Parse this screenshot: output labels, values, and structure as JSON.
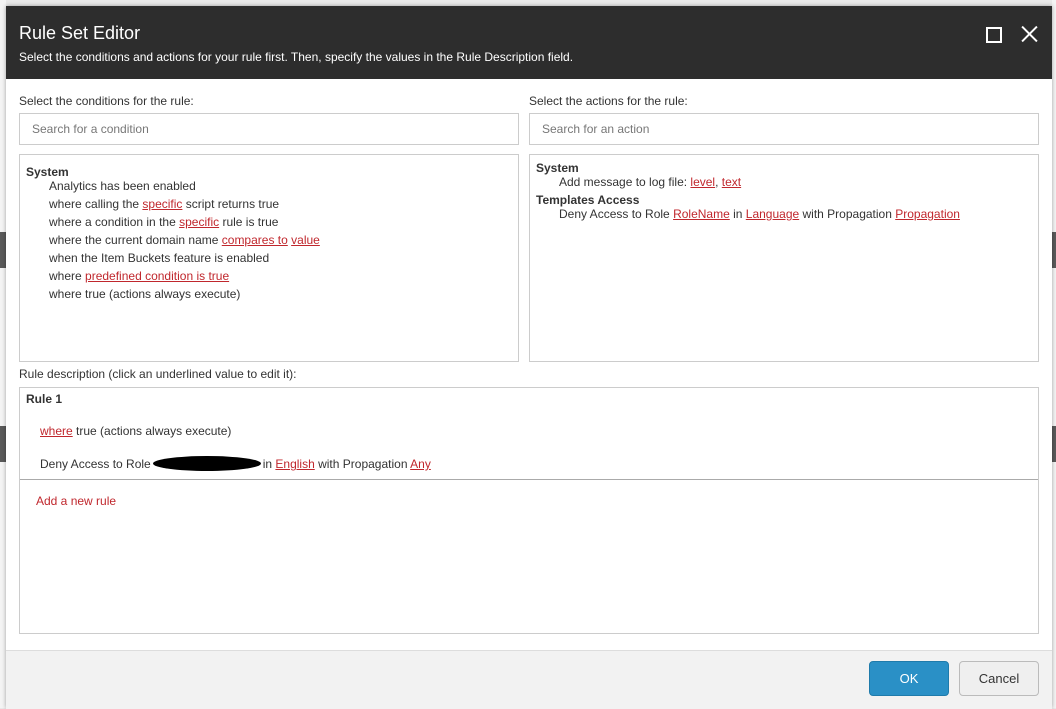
{
  "dialog": {
    "title": "Rule Set Editor",
    "subtitle": "Select the conditions and actions for your rule first. Then, specify the values in the Rule Description field."
  },
  "conditions": {
    "label": "Select the conditions for the rule:",
    "search_placeholder": "Search for a condition",
    "group": "System",
    "items": [
      {
        "parts": [
          "Analytics has been enabled"
        ]
      },
      {
        "parts": [
          "where calling the ",
          "specific",
          " script returns true"
        ]
      },
      {
        "parts": [
          "where a condition in the ",
          "specific",
          " rule is true"
        ]
      },
      {
        "parts": [
          "where the current domain name ",
          "compares to",
          " ",
          "value"
        ]
      },
      {
        "parts": [
          "when the Item Buckets feature is enabled"
        ]
      },
      {
        "parts": [
          "where ",
          "predefined condition is true"
        ]
      },
      {
        "parts": [
          "where true (actions always execute)"
        ]
      }
    ]
  },
  "actions": {
    "label": "Select the actions for the rule:",
    "search_placeholder": "Search for an action",
    "groups": [
      {
        "name": "System",
        "items": [
          {
            "parts": [
              "Add message to log file: ",
              "level",
              ", ",
              "text"
            ]
          }
        ]
      },
      {
        "name": "Templates Access",
        "items": [
          {
            "parts": [
              "Deny Access to Role ",
              "RoleName",
              " in ",
              "Language",
              " with Propagation ",
              "Propagation"
            ]
          }
        ]
      }
    ]
  },
  "rule_description": {
    "label": "Rule description (click an underlined value to edit it):",
    "rule_title": "Rule 1",
    "condition_link": "where",
    "condition_text": " true (actions always execute)",
    "action_prefix": "Deny Access to Role",
    "action_in": "in ",
    "language": "English",
    "action_with": " with Propagation ",
    "propagation": "Any",
    "add_rule": "Add a new rule"
  },
  "footer": {
    "ok": "OK",
    "cancel": "Cancel"
  },
  "colors": {
    "titlebar": "#2d2d2d",
    "link": "#c0272d",
    "ok_button": "#2a90c6"
  }
}
